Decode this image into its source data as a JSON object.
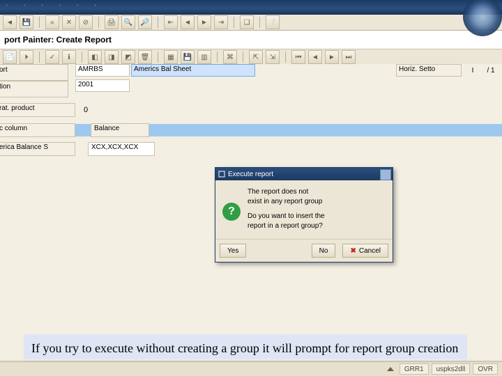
{
  "window_title": "port Painter: Create Report",
  "menubar": [
    "",
    "",
    "",
    "",
    "",
    "",
    ""
  ],
  "form": {
    "report_label_1": "ort",
    "report_label_2": "tion",
    "report_code": "AMRBS",
    "report_year": "2001",
    "report_desc": "Americs Bal Sheet",
    "status_label": "Horiz. Setto",
    "status_sep": "I",
    "status_page_total": "/ 1",
    "prod_label": "rat. product",
    "prod_val": "0",
    "col_label": "c column",
    "balance_label": "Balance",
    "row1_label": "erica Balance S",
    "row1_value": "XCX,XCX,XCX"
  },
  "dialog": {
    "title": "Execute report",
    "line1": "The report does not",
    "line2": "exist in any report group",
    "line3": "Do you want to insert the",
    "line4": "report in a report group?",
    "yes": "Yes",
    "no": "No",
    "cancel": "Cancel"
  },
  "caption": "If you try to execute without creating a group it will prompt for report group creation",
  "statusbar": {
    "tcode": "GRR1",
    "server": "uspks2dll",
    "mode": "OVR"
  }
}
